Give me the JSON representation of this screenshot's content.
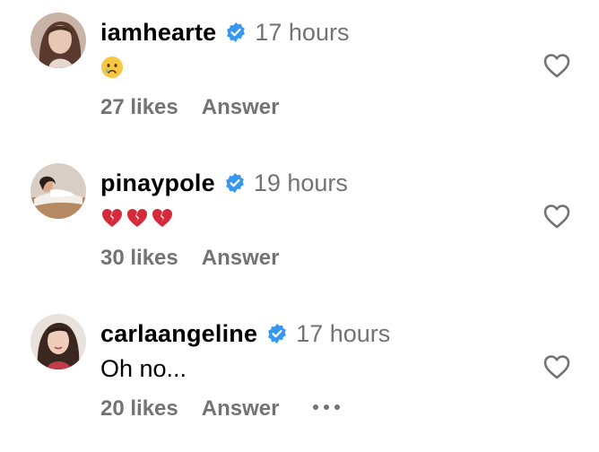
{
  "comments": [
    {
      "username": "iamhearte",
      "time": "17 hours",
      "text": "",
      "emoji": "crying-face",
      "likes": "27 likes",
      "answer": "Answer",
      "has_more": false
    },
    {
      "username": "pinaypole",
      "time": "19 hours",
      "text": "",
      "emoji": "broken-heart-x3",
      "likes": "30 likes",
      "answer": "Answer",
      "has_more": false
    },
    {
      "username": "carlaangeline",
      "time": "17 hours",
      "text": "Oh no...",
      "emoji": "",
      "likes": "20 likes",
      "answer": "Answer",
      "has_more": true
    }
  ],
  "colors": {
    "verified": "#3897f0",
    "secondary_text": "#737373",
    "text": "#000000"
  },
  "icons": {
    "verified": "verified-badge-icon",
    "like": "heart-outline-icon",
    "more": "more-options-icon"
  }
}
